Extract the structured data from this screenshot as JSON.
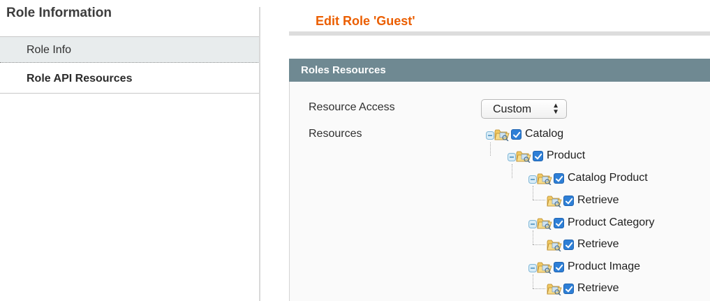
{
  "sidebar": {
    "title": "Role Information",
    "tabs": [
      {
        "label": "Role Info"
      },
      {
        "label": "Role API Resources"
      }
    ]
  },
  "main": {
    "title": "Edit Role 'Guest'",
    "section": {
      "header": "Roles Resources",
      "resource_access_label": "Resource Access",
      "resource_access_value": "Custom",
      "resources_label": "Resources"
    },
    "tree": [
      {
        "label": "Catalog",
        "checked": true,
        "icon": "folder-icon"
      },
      {
        "label": "Product",
        "checked": true,
        "icon": "folder-icon"
      },
      {
        "label": "Catalog Product",
        "checked": true,
        "icon": "folder-icon"
      },
      {
        "label": "Retrieve",
        "checked": true,
        "icon": "folder-icon"
      },
      {
        "label": "Product Category",
        "checked": true,
        "icon": "folder-icon"
      },
      {
        "label": "Retrieve",
        "checked": true,
        "icon": "folder-icon"
      },
      {
        "label": "Product Image",
        "checked": true,
        "icon": "folder-icon"
      },
      {
        "label": "Retrieve",
        "checked": true,
        "icon": "folder-icon"
      }
    ]
  },
  "colors": {
    "accent_title": "#eb5e00",
    "section_header": "#6f8992",
    "checkbox": "#2e7fd6",
    "active_tab_bg": "#e8eced"
  }
}
